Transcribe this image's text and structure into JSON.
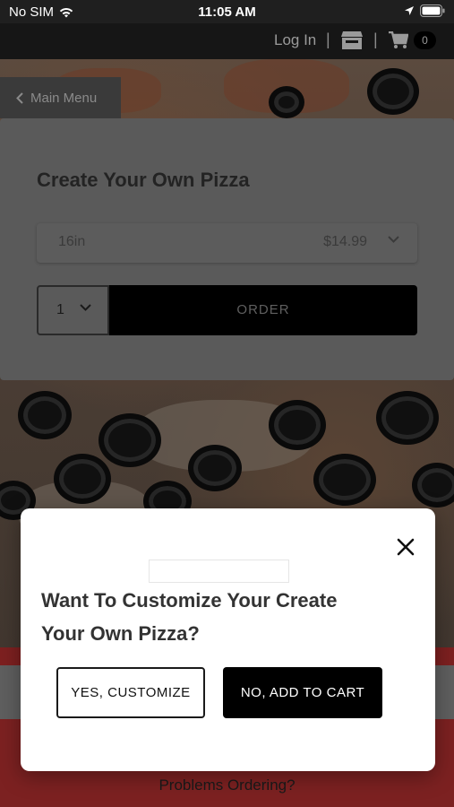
{
  "status_bar": {
    "carrier": "No SIM",
    "time": "11:05 AM"
  },
  "nav": {
    "login_label": "Log In",
    "separator": "|",
    "cart_count": "0"
  },
  "back": {
    "label": "Main Menu"
  },
  "product": {
    "title": "Create Your Own Pizza",
    "selected_size": "16in",
    "selected_price": "$14.99",
    "quantity": "1",
    "order_label": "ORDER"
  },
  "modal": {
    "question": "Want To Customize Your Create Your Own Pizza?",
    "yes_label": "YES, CUSTOMIZE",
    "no_label": "NO, ADD TO CART"
  },
  "footer": {
    "problems_label": "Problems Ordering?"
  },
  "colors": {
    "accent_red": "#7c2121",
    "order_button": "#000000",
    "overlay": "rgba(0,0,0,0.55)"
  }
}
